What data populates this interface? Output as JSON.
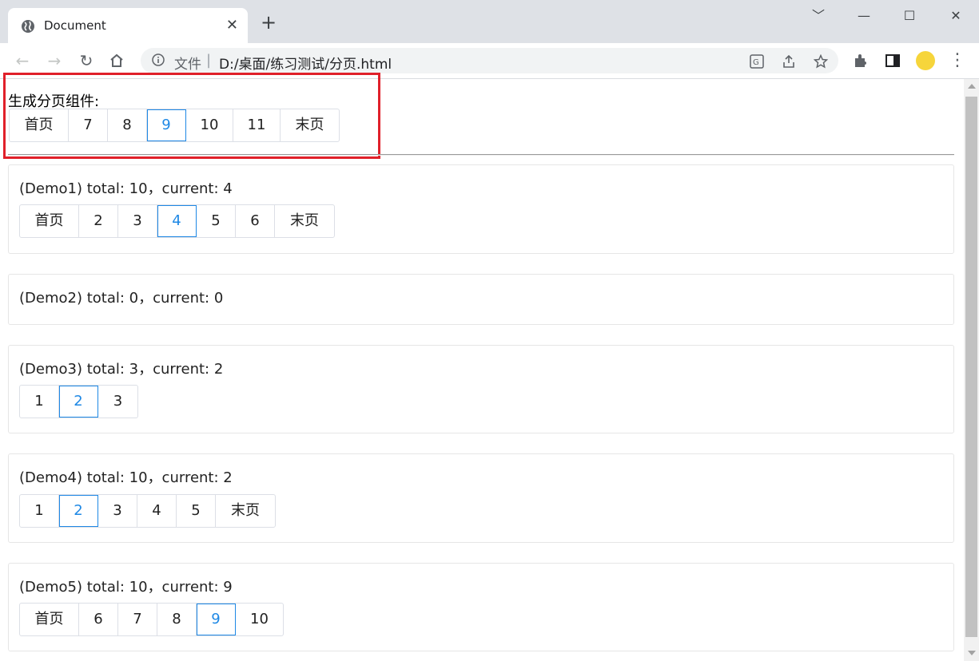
{
  "browser": {
    "tab_title": "Document",
    "close_glyph": "✕",
    "new_tab_glyph": "+",
    "omnibox_label": "文件",
    "separator": "|",
    "url": "D:/桌面/练习测试/分页.html",
    "window_controls": [
      "﹀",
      "—",
      "☐",
      "✕"
    ]
  },
  "page": {
    "heading": "生成分页组件:",
    "top_pager": [
      {
        "label": "首页",
        "active": false
      },
      {
        "label": "7",
        "active": false
      },
      {
        "label": "8",
        "active": false
      },
      {
        "label": "9",
        "active": true
      },
      {
        "label": "10",
        "active": false
      },
      {
        "label": "11",
        "active": false
      },
      {
        "label": "末页",
        "active": false
      }
    ],
    "demos": [
      {
        "title": "(Demo1) total: 10，current: 4",
        "pager": [
          {
            "label": "首页",
            "active": false
          },
          {
            "label": "2",
            "active": false
          },
          {
            "label": "3",
            "active": false
          },
          {
            "label": "4",
            "active": true
          },
          {
            "label": "5",
            "active": false
          },
          {
            "label": "6",
            "active": false
          },
          {
            "label": "末页",
            "active": false
          }
        ]
      },
      {
        "title": "(Demo2) total: 0，current: 0",
        "pager": []
      },
      {
        "title": "(Demo3) total: 3，current: 2",
        "pager": [
          {
            "label": "1",
            "active": false
          },
          {
            "label": "2",
            "active": true
          },
          {
            "label": "3",
            "active": false
          }
        ]
      },
      {
        "title": "(Demo4) total: 10，current: 2",
        "pager": [
          {
            "label": "1",
            "active": false
          },
          {
            "label": "2",
            "active": true
          },
          {
            "label": "3",
            "active": false
          },
          {
            "label": "4",
            "active": false
          },
          {
            "label": "5",
            "active": false
          },
          {
            "label": "末页",
            "active": false
          }
        ]
      },
      {
        "title": "(Demo5) total: 10，current: 9",
        "pager": [
          {
            "label": "首页",
            "active": false
          },
          {
            "label": "6",
            "active": false
          },
          {
            "label": "7",
            "active": false
          },
          {
            "label": "8",
            "active": false
          },
          {
            "label": "9",
            "active": true
          },
          {
            "label": "10",
            "active": false
          }
        ]
      }
    ]
  },
  "colors": {
    "active": "#1e88e5",
    "highlight_box": "#e0202a",
    "border": "#dcdfe6"
  }
}
